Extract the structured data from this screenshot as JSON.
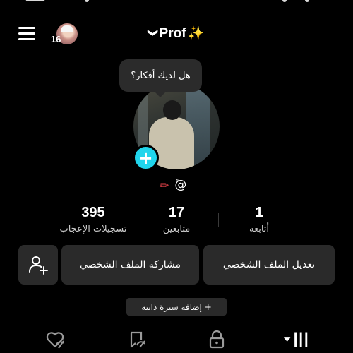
{
  "header": {
    "title": "Prof",
    "sparkle": "✨",
    "chevron": "❯",
    "friend_count": "16",
    "menu_icon": "hamburger-menu-icon"
  },
  "bubble": {
    "text": "هل لديك أفكار؟"
  },
  "profile": {
    "handle_prefix": "@",
    "handle_mark": "ً",
    "edit_pen": "✏"
  },
  "stats": [
    {
      "value": "1",
      "label": "أتابعه"
    },
    {
      "value": "17",
      "label": "متابعين"
    },
    {
      "value": "395",
      "label": "تسجيلات الإعجاب"
    }
  ],
  "buttons": {
    "edit_profile": "تعديل الملف الشخصي",
    "share_profile": "مشاركة الملف الشخصي"
  },
  "bio": {
    "label": "+ إضافة سيرة ذاتية"
  },
  "tabs": [
    {
      "icon": "grid-videos-icon"
    },
    {
      "icon": "lock-icon"
    },
    {
      "icon": "reposts-icon"
    },
    {
      "icon": "liked-videos-icon"
    }
  ]
}
